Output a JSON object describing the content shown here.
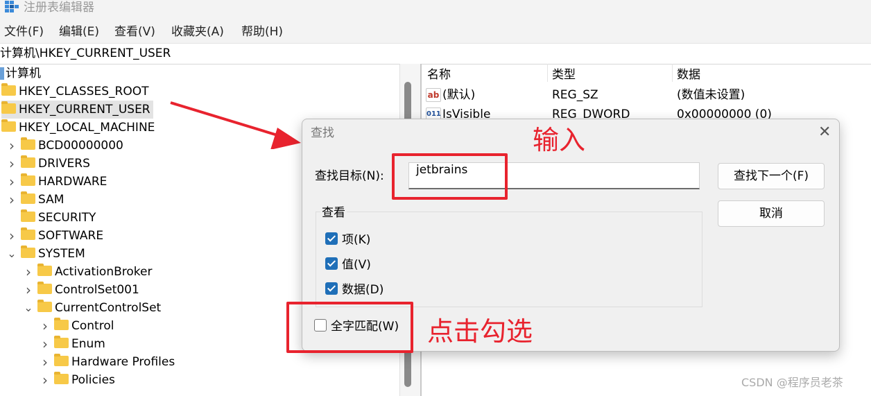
{
  "app": {
    "title": "注册表编辑器"
  },
  "menu": [
    "文件(F)",
    "编辑(E)",
    "查看(V)",
    "收藏夹(A)",
    "帮助(H)"
  ],
  "address": "计算机\\HKEY_CURRENT_USER",
  "tree": {
    "root": "计算机",
    "items": [
      {
        "label": "HKEY_CLASSES_ROOT",
        "level": 0,
        "expander": "none"
      },
      {
        "label": "HKEY_CURRENT_USER",
        "level": 0,
        "expander": "none",
        "selected": true
      },
      {
        "label": "HKEY_LOCAL_MACHINE",
        "level": 0,
        "expander": "none"
      },
      {
        "label": "BCD00000000",
        "level": 1,
        "expander": "collapsed"
      },
      {
        "label": "DRIVERS",
        "level": 1,
        "expander": "collapsed"
      },
      {
        "label": "HARDWARE",
        "level": 1,
        "expander": "collapsed"
      },
      {
        "label": "SAM",
        "level": 1,
        "expander": "collapsed"
      },
      {
        "label": "SECURITY",
        "level": 1,
        "expander": "none"
      },
      {
        "label": "SOFTWARE",
        "level": 1,
        "expander": "collapsed"
      },
      {
        "label": "SYSTEM",
        "level": 1,
        "expander": "expanded"
      },
      {
        "label": "ActivationBroker",
        "level": 2,
        "expander": "collapsed"
      },
      {
        "label": "ControlSet001",
        "level": 2,
        "expander": "collapsed"
      },
      {
        "label": "CurrentControlSet",
        "level": 2,
        "expander": "expanded"
      },
      {
        "label": "Control",
        "level": 3,
        "expander": "collapsed"
      },
      {
        "label": "Enum",
        "level": 3,
        "expander": "collapsed"
      },
      {
        "label": "Hardware Profiles",
        "level": 3,
        "expander": "collapsed"
      },
      {
        "label": "Policies",
        "level": 3,
        "expander": "collapsed"
      }
    ]
  },
  "values": {
    "headers": [
      "名称",
      "类型",
      "数据"
    ],
    "rows": [
      {
        "icon": "string-value-icon",
        "name": "(默认)",
        "type": "REG_SZ",
        "data": "(数值未设置)"
      },
      {
        "icon": "dword-value-icon",
        "name": "IsVisible",
        "type": "REG_DWORD",
        "data": "0x00000000 (0)"
      }
    ]
  },
  "find_dialog": {
    "title": "查找",
    "find_label": "查找目标(N):",
    "find_value": "jetbrains",
    "find_next_label": "查找下一个(F)",
    "cancel_label": "取消",
    "look_at_label": "查看",
    "options": [
      {
        "label": "项(K)",
        "checked": true
      },
      {
        "label": "值(V)",
        "checked": true
      },
      {
        "label": "数据(D)",
        "checked": true
      }
    ],
    "match_whole": {
      "label": "全字匹配(W)",
      "checked": false
    }
  },
  "annotations": {
    "input_note": "输入",
    "check_note": "点击勾选",
    "color": "#e8232e"
  },
  "watermark": "CSDN @程序员老茶"
}
